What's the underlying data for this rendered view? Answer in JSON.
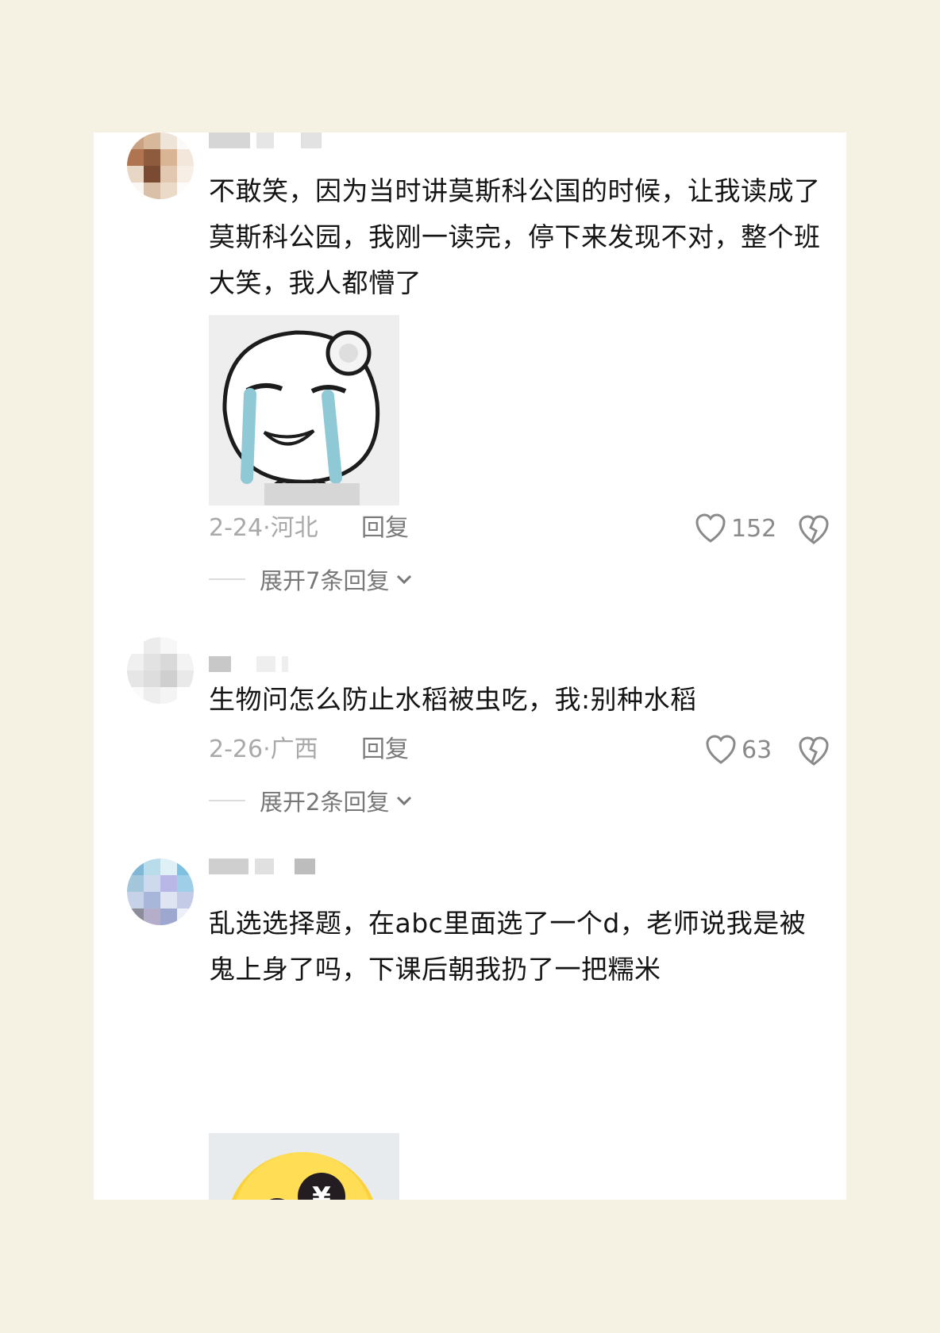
{
  "comments": [
    {
      "text": "不敢笑，因为当时讲莫斯科公国的时候，让我读成了莫斯科公园，我刚一读完，停下来发现不对，整个班大笑，我人都懵了",
      "sticker": "crying-bear-sticker",
      "date": "2-24·河北",
      "reply_label": "回复",
      "likes": "152",
      "expand_label": "展开7条回复"
    },
    {
      "text": "生物问怎么防止水稻被虫吃，我:别种水稻",
      "date": "2-26·广西",
      "reply_label": "回复",
      "likes": "63",
      "expand_label": "展开2条回复"
    },
    {
      "text": "乱选选择题，在abc里面选了一个d，老师说我是被鬼上身了吗，下课后朝我扔了一把糯米",
      "sticker": "crying-money-emoji-sticker"
    }
  ],
  "icons": {
    "like": "heart-outline-icon",
    "dislike": "broken-heart-icon",
    "expand": "chevron-down-icon"
  },
  "colors": {
    "page_background": "#f6f2e3",
    "card_background": "#ffffff",
    "meta_text": "#a9a9a9",
    "action_text": "#7a7a7a"
  }
}
